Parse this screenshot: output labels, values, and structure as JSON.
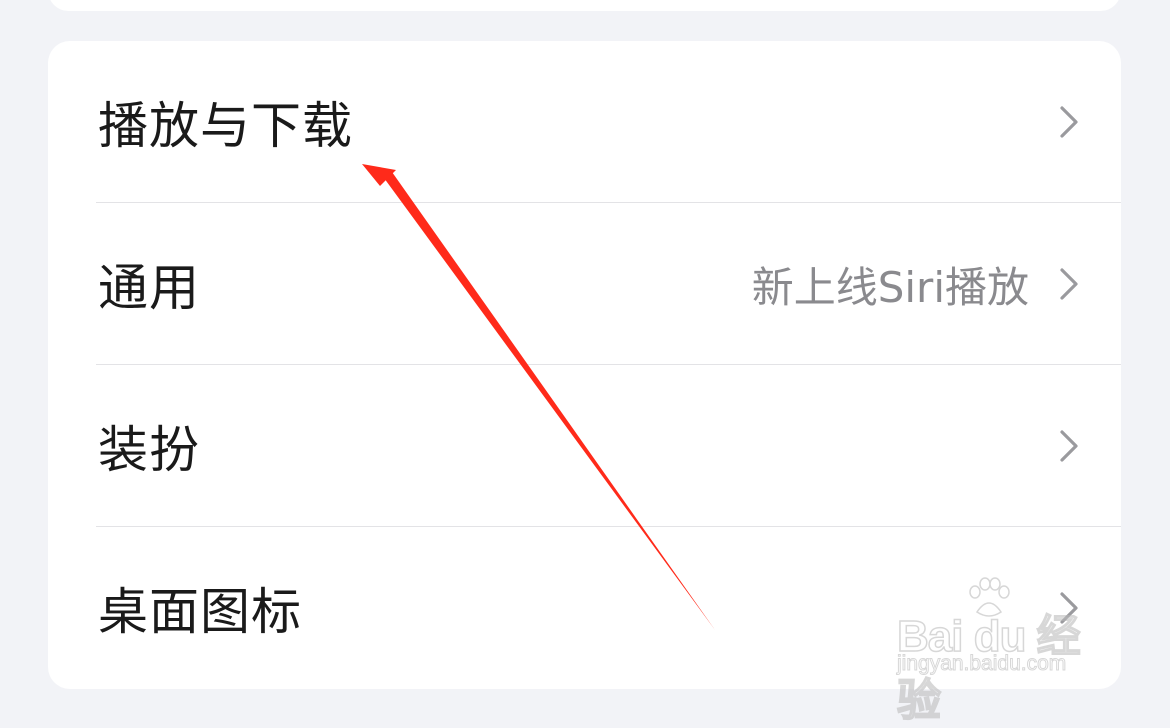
{
  "settings": {
    "items": [
      {
        "label": "播放与下载",
        "value": ""
      },
      {
        "label": "通用",
        "value": "新上线Siri播放"
      },
      {
        "label": "装扮",
        "value": ""
      },
      {
        "label": "桌面图标",
        "value": ""
      }
    ]
  },
  "icons": {
    "row_chevron": "chevron-right-icon"
  },
  "colors": {
    "annotation_arrow": "#ff2a1a",
    "background": "#f2f3f7",
    "card": "#ffffff"
  },
  "watermark": {
    "brand": "Bai du 经验",
    "url": "jingyan.baidu.com"
  }
}
